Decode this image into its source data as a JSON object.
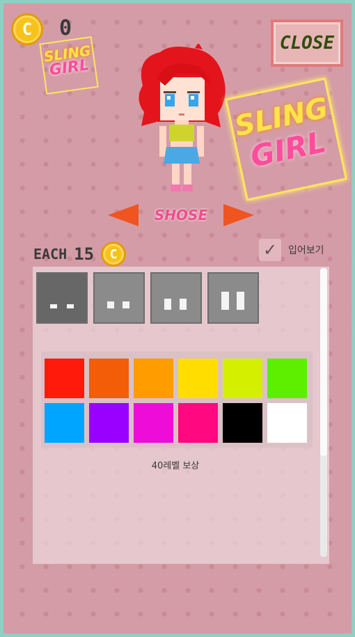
{
  "coins": {
    "icon": "coin-icon",
    "glyph": "C",
    "count": "0"
  },
  "close_label": "CLOSE",
  "sign_small": {
    "line1": "SLING",
    "line2": "GIRL"
  },
  "sign_big": {
    "line1": "SLING",
    "line2": "GIRL"
  },
  "part_selector": {
    "label": "SHOSE",
    "prev_icon": "arrow-left-icon",
    "next_icon": "arrow-right-icon"
  },
  "price": {
    "label": "EACH",
    "value": "15",
    "coin_glyph": "C"
  },
  "try_on": {
    "checked": true,
    "check_glyph": "✓",
    "label": "입어보기"
  },
  "shoe_styles": [
    {
      "name": "shoe-style-1",
      "selected": true
    },
    {
      "name": "shoe-style-2",
      "selected": false
    },
    {
      "name": "shoe-style-3",
      "selected": false
    },
    {
      "name": "shoe-style-4",
      "selected": false
    }
  ],
  "colors": [
    "#ff1a0c",
    "#f45d07",
    "#ff9c00",
    "#ffdd00",
    "#d4ef00",
    "#5eee00",
    "#00a5ff",
    "#9900ff",
    "#ee0cd8",
    "#ff0880",
    "#000000",
    "#ffffff"
  ],
  "reward_text": "40레벨 보상"
}
